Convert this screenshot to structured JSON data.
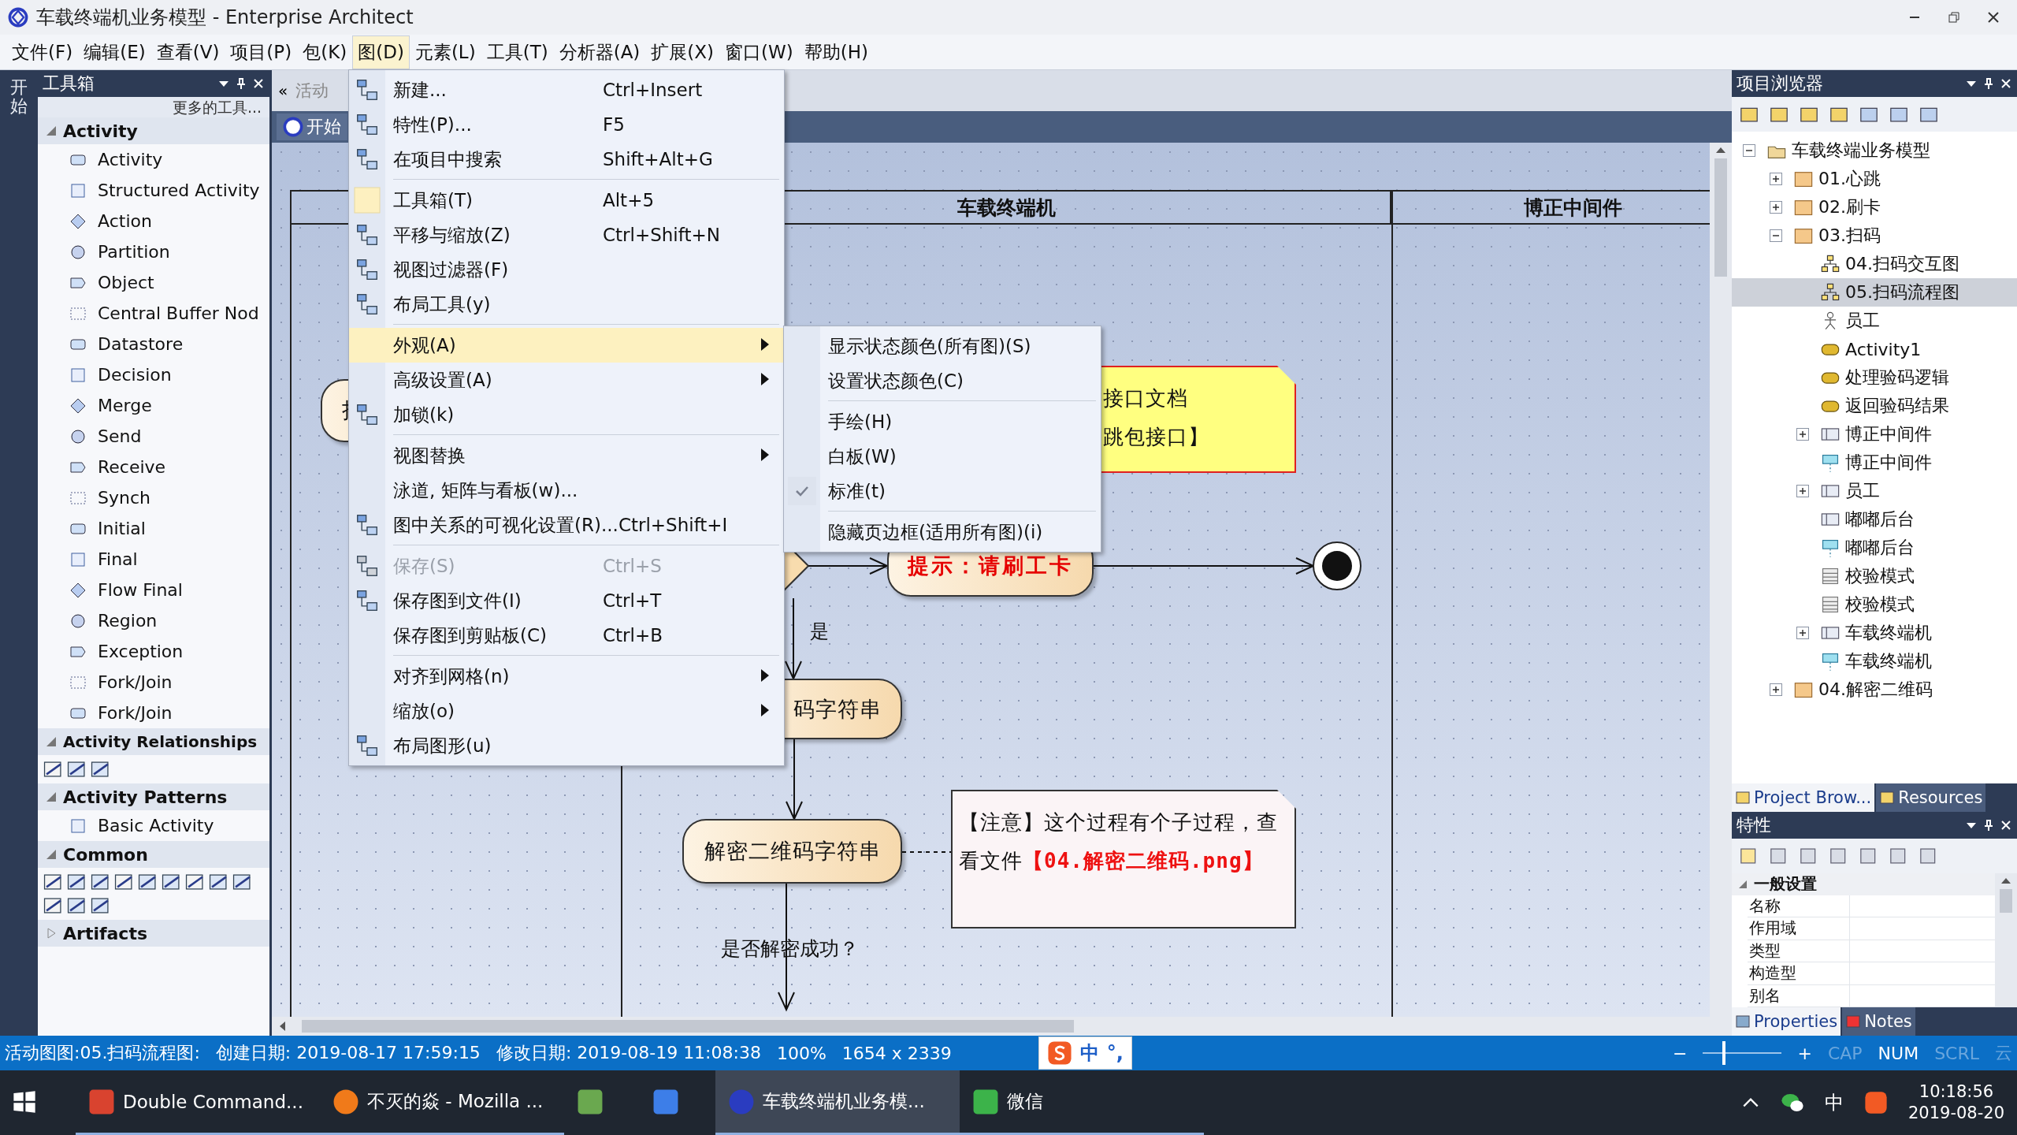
{
  "window": {
    "title": "车载终端机业务模型 - Enterprise Architect"
  },
  "menu_bar": [
    {
      "label": "文件(F)",
      "selected": false
    },
    {
      "label": "编辑(E)",
      "selected": false
    },
    {
      "label": "查看(V)",
      "selected": false
    },
    {
      "label": "项目(P)",
      "selected": false
    },
    {
      "label": "包(K)",
      "selected": false
    },
    {
      "label": "图(D)",
      "selected": true
    },
    {
      "label": "元素(L)",
      "selected": false
    },
    {
      "label": "工具(T)",
      "selected": false
    },
    {
      "label": "分析器(A)",
      "selected": false
    },
    {
      "label": "扩展(X)",
      "selected": false
    },
    {
      "label": "窗口(W)",
      "selected": false
    },
    {
      "label": "帮助(H)",
      "selected": false
    }
  ],
  "side_strip": {
    "label": "开始"
  },
  "toolbox": {
    "title": "工具箱",
    "more": "更多的工具...",
    "sections": [
      {
        "title": "Activity",
        "kind": "list",
        "expanded": true,
        "items": [
          "Activity",
          "Structured Activity",
          "Action",
          "Partition",
          "Object",
          "Central Buffer Nod",
          "Datastore",
          "Decision",
          "Merge",
          "Send",
          "Receive",
          "Synch",
          "Initial",
          "Final",
          "Flow Final",
          "Region",
          "Exception",
          "Fork/Join",
          "Fork/Join"
        ]
      },
      {
        "title": "Activity Relationships",
        "kind": "icons",
        "expanded": true
      },
      {
        "title": "Activity Patterns",
        "kind": "list",
        "expanded": true,
        "items": [
          "Basic Activity"
        ]
      },
      {
        "title": "Common",
        "kind": "icons",
        "expanded": true
      },
      {
        "title": "Artifacts",
        "expanded": false
      }
    ]
  },
  "diagram": {
    "nav": "«",
    "tabs": [
      {
        "label": "活动",
        "selected": false
      }
    ],
    "page_tab": "开始",
    "lanes": [
      {
        "label": "车载终端机"
      },
      {
        "label": "博正中间件"
      }
    ],
    "actions": [
      {
        "label": "扌",
        "emphasis": false
      },
      {
        "label": "提示：请刷工卡",
        "emphasis": true
      },
      {
        "label": "码字符串",
        "emphasis": false
      },
      {
        "label": "解密二维码字符串",
        "emphasis": false
      }
    ],
    "guards": [
      "是",
      "是否解密成功？"
    ],
    "notes": [
      {
        "kind": "warning",
        "lines": [
          "接口文档",
          "跳包接口】"
        ]
      },
      {
        "kind": "plain",
        "lines": [
          "【注意】这个过程有个子过程，查",
          "看文件**【04.解密二维码.png】**"
        ]
      }
    ]
  },
  "context_menu": {
    "groups": [
      [
        {
          "label": "新建...",
          "shortcut": "Ctrl+Insert",
          "submenu": false,
          "disabled": false,
          "selected": false
        },
        {
          "label": "特性(P)...",
          "shortcut": "F5",
          "submenu": false,
          "disabled": false,
          "selected": false
        },
        {
          "label": "在项目中搜索",
          "shortcut": "Shift+Alt+G",
          "submenu": false,
          "disabled": false,
          "selected": false
        }
      ],
      [
        {
          "label": "工具箱(T)",
          "shortcut": "Alt+5",
          "submenu": false,
          "disabled": false,
          "selected": false
        },
        {
          "label": "平移与缩放(Z)",
          "shortcut": "Ctrl+Shift+N",
          "submenu": false,
          "disabled": false,
          "selected": false
        },
        {
          "label": "视图过滤器(F)",
          "submenu": false,
          "disabled": false,
          "selected": false
        },
        {
          "label": "布局工具(y)",
          "submenu": false,
          "disabled": false,
          "selected": false
        }
      ],
      [
        {
          "label": "外观(A)",
          "submenu": true,
          "disabled": false,
          "selected": true
        },
        {
          "label": "高级设置(A)",
          "submenu": true,
          "disabled": false,
          "selected": false
        },
        {
          "label": "加锁(k)",
          "submenu": false,
          "disabled": false,
          "selected": false
        }
      ],
      [
        {
          "label": "视图替换",
          "submenu": true,
          "disabled": false,
          "selected": false
        },
        {
          "label": "泳道, 矩阵与看板(w)...",
          "submenu": false,
          "disabled": false,
          "selected": false
        },
        {
          "label": "图中关系的可视化设置(R)...",
          "shortcut": "Ctrl+Shift+I",
          "submenu": false,
          "disabled": false,
          "selected": false
        }
      ],
      [
        {
          "label": "保存(S)",
          "shortcut": "Ctrl+S",
          "submenu": false,
          "disabled": true,
          "selected": false
        },
        {
          "label": "保存图到文件(I)",
          "shortcut": "Ctrl+T",
          "submenu": false,
          "disabled": false,
          "selected": false
        },
        {
          "label": "保存图到剪贴板(C)",
          "shortcut": "Ctrl+B",
          "submenu": false,
          "disabled": false,
          "selected": false
        }
      ],
      [
        {
          "label": "对齐到网格(n)",
          "submenu": true,
          "disabled": false,
          "selected": false
        },
        {
          "label": "缩放(o)",
          "submenu": true,
          "disabled": false,
          "selected": false
        },
        {
          "label": "布局图形(u)",
          "submenu": false,
          "disabled": false,
          "selected": false
        }
      ]
    ]
  },
  "submenu_panel": {
    "groups": [
      [
        {
          "label": "显示状态颜色(所有图)(S)",
          "checked": false
        },
        {
          "label": "设置状态颜色(C)",
          "checked": false
        }
      ],
      [
        {
          "label": "手绘(H)",
          "checked": false
        },
        {
          "label": "白板(W)",
          "checked": false
        },
        {
          "label": "标准(t)",
          "checked": true
        }
      ],
      [
        {
          "label": "隐藏页边框(适用所有图)(i)",
          "checked": false
        }
      ]
    ]
  },
  "project_browser": {
    "title": "项目浏览器",
    "tree": [
      {
        "label": "车载终端业务模型",
        "kind": "model",
        "expanded": true,
        "selected": false,
        "children": [
          {
            "label": "01.心跳",
            "kind": "package",
            "expanded": false,
            "selected": false
          },
          {
            "label": "02.刷卡",
            "kind": "package",
            "expanded": false,
            "selected": false
          },
          {
            "label": "03.扫码",
            "kind": "package",
            "expanded": true,
            "selected": false,
            "children": [
              {
                "label": "04.扫码交互图",
                "kind": "diagram",
                "selected": false
              },
              {
                "label": "05.扫码流程图",
                "kind": "diagram",
                "selected": true
              },
              {
                "label": "员工",
                "kind": "actor",
                "selected": false
              },
              {
                "label": "Activity1",
                "kind": "activity",
                "selected": false
              },
              {
                "label": "处理验码逻辑",
                "kind": "activity",
                "selected": false
              },
              {
                "label": "返回验码结果",
                "kind": "activity",
                "selected": false
              },
              {
                "label": "博正中间件",
                "kind": "partition",
                "expanded": false,
                "selected": false
              },
              {
                "label": "博正中间件",
                "kind": "lifeline",
                "selected": false
              },
              {
                "label": "员工",
                "kind": "partition",
                "expanded": false,
                "selected": false
              },
              {
                "label": "嘟嘟后台",
                "kind": "partition",
                "selected": false
              },
              {
                "label": "嘟嘟后台",
                "kind": "lifeline",
                "selected": false
              },
              {
                "label": "校验模式",
                "kind": "class",
                "selected": false
              },
              {
                "label": "校验模式",
                "kind": "class",
                "selected": false
              },
              {
                "label": "车载终端机",
                "kind": "partition",
                "expanded": false,
                "selected": false
              },
              {
                "label": "车载终端机",
                "kind": "lifeline",
                "selected": false
              }
            ]
          },
          {
            "label": "04.解密二维码",
            "kind": "package",
            "expanded": false,
            "selected": false
          }
        ]
      }
    ],
    "tabs": [
      {
        "label": "Project Brow...",
        "selected": true
      },
      {
        "label": "Resources",
        "selected": false
      }
    ]
  },
  "properties": {
    "title": "特性",
    "group": "一般设置",
    "rows": [
      "名称",
      "作用域",
      "类型",
      "构造型",
      "别名"
    ],
    "tabs": [
      {
        "label": "Properties",
        "selected": true
      },
      {
        "label": "Notes",
        "selected": false
      }
    ]
  },
  "status_bar": {
    "diagram": "活动图图:05.扫码流程图:",
    "created": "创建日期: 2019-08-17 17:59:15",
    "modified": "修改日期: 2019-08-19 11:08:38",
    "zoom": "100%",
    "size": "1654 x 2339",
    "ime": [
      "中",
      "°,"
    ],
    "zoom_out": "−",
    "zoom_in": "+",
    "zoom_slider": {
      "level": 0.25
    },
    "indicators": [
      {
        "label": "CAP",
        "on": false
      },
      {
        "label": "NUM",
        "on": true
      },
      {
        "label": "SCRL",
        "on": false
      },
      {
        "label": "云",
        "on": false
      }
    ]
  },
  "taskbar": {
    "tasks": [
      {
        "label": "Double Command...",
        "selected": false
      },
      {
        "label": "不灭的焱 - Mozilla ...",
        "selected": false
      },
      {
        "selected": false
      },
      {
        "selected": false
      },
      {
        "label": "车载终端机业务模...",
        "selected": true
      },
      {
        "label": "微信",
        "selected": false
      }
    ],
    "tray": {
      "ime": "中",
      "time": "10:18:56",
      "date": "2019-08-20"
    }
  }
}
